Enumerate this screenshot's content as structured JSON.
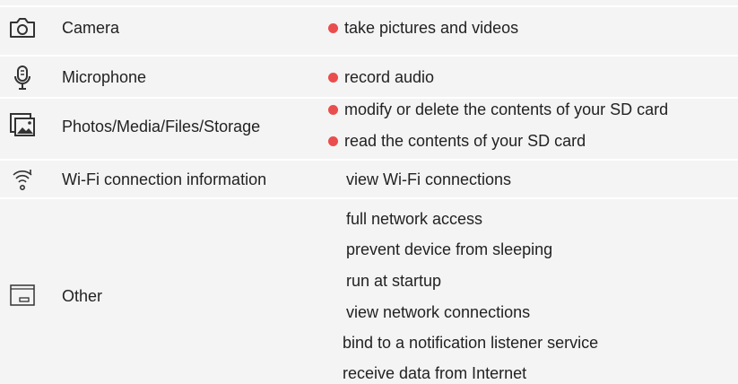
{
  "colors": {
    "danger_dot": "#ea4d4d",
    "background": "#f4f4f4",
    "separator": "#ffffff"
  },
  "groups": [
    {
      "icon": "camera-icon",
      "label": "Camera",
      "permissions": [
        {
          "text": "take pictures and videos",
          "dangerous": true
        }
      ]
    },
    {
      "icon": "microphone-icon",
      "label": "Microphone",
      "permissions": [
        {
          "text": "record audio",
          "dangerous": true
        }
      ]
    },
    {
      "icon": "photos-icon",
      "label": "Photos/Media/Files/Storage",
      "permissions": [
        {
          "text": "modify or delete the contents of your SD card",
          "dangerous": true
        },
        {
          "text": "read the contents of your SD card",
          "dangerous": true
        }
      ]
    },
    {
      "icon": "wifi-icon",
      "label": "Wi-Fi connection information",
      "permissions": [
        {
          "text": "view Wi-Fi connections",
          "dangerous": false
        }
      ]
    },
    {
      "icon": "folder-icon",
      "label": "Other",
      "permissions": [
        {
          "text": "full network access",
          "dangerous": false
        },
        {
          "text": "prevent device from sleeping",
          "dangerous": false
        },
        {
          "text": "run at startup",
          "dangerous": false
        },
        {
          "text": "view network connections",
          "dangerous": false
        },
        {
          "text": "bind to a notification listener service",
          "dangerous": false
        },
        {
          "text": "receive data from Internet",
          "dangerous": false
        }
      ]
    }
  ]
}
